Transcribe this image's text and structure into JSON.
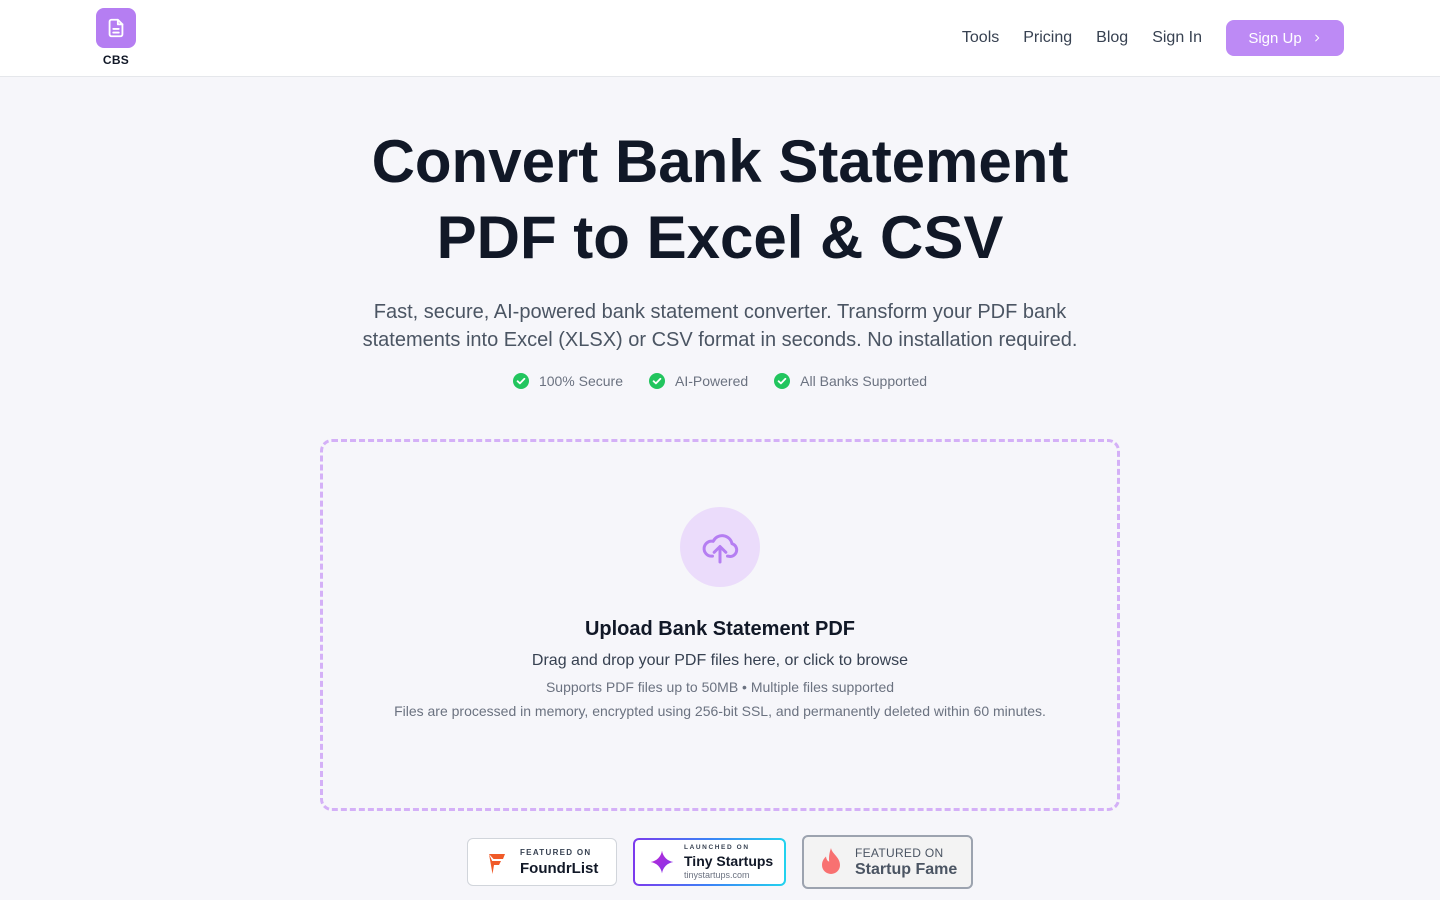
{
  "header": {
    "logo_text": "CBS",
    "nav": [
      "Tools",
      "Pricing",
      "Blog",
      "Sign In"
    ],
    "signup_label": "Sign Up"
  },
  "hero": {
    "title_line1": "Convert Bank Statement",
    "title_line2": "PDF to Excel & CSV",
    "subtitle": "Fast, secure, AI-powered bank statement converter. Transform your PDF bank statements into Excel (XLSX) or CSV format in seconds. No installation required.",
    "features": [
      "100% Secure",
      "AI-Powered",
      "All Banks Supported"
    ]
  },
  "upload": {
    "title": "Upload Bank Statement PDF",
    "description": "Drag and drop your PDF files here, or click to browse",
    "meta": "Supports PDF files up to 50MB • Multiple files supported",
    "privacy": "Files are processed in memory, encrypted using 256-bit SSL, and permanently deleted within 60 minutes."
  },
  "badges": {
    "foundr": {
      "small": "FEATURED ON",
      "big": "FoundrList"
    },
    "tiny": {
      "small": "LAUNCHED ON",
      "big": "Tiny Startups",
      "url": "tinystartups.com"
    },
    "fame": {
      "small": "FEATURED ON",
      "big": "Startup Fame"
    }
  },
  "colors": {
    "accent": "#bd8af5",
    "logo_bg": "#b57ef2",
    "upload_border": "#d4b0f7",
    "check_green": "#22c55e"
  },
  "icons": {
    "logo": "document-icon",
    "upload": "cloud-upload-icon",
    "feature": "check-circle-icon",
    "signup": "chevron-right-icon"
  }
}
